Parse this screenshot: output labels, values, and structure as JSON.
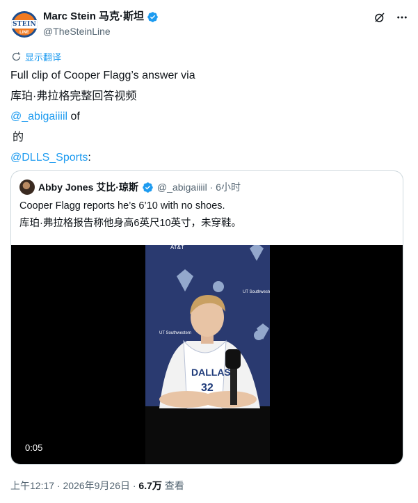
{
  "author": {
    "display_name": "Marc Stein 马克·斯坦",
    "handle": "@TheSteinLine",
    "avatar_text": "STEIN",
    "avatar_subtext": "LINE"
  },
  "translate_label": "显示翻译",
  "tweet": {
    "line1": "Full clip of Cooper Flagg’s answer via",
    "line2": "库珀·弗拉格完整回答视频",
    "mention1": "@_abigaiiiil",
    "after_mention1": " of",
    "line4": "的",
    "mention2": "@DLLS_Sports",
    "after_mention2": ":"
  },
  "quote": {
    "display_name": "Abby Jones 艾比·琼斯",
    "handle_time": "@_abigaiiiil · 6小时",
    "text_en": "Cooper Flagg reports he’s 6’10 with no shoes.",
    "text_zh": "库珀·弗拉格报告称他身高6英尺10英寸，未穿鞋。",
    "video_duration": "0:05"
  },
  "meta": {
    "time_date": "上午12:17 · 2026年9月26日 · ",
    "views_count": "6.7万",
    "views_label": " 查看"
  },
  "video_frame_text": {
    "jersey": "DALLAS",
    "jersey_number": "32",
    "sponsor": "UT Southwestern",
    "att": "AT&T"
  },
  "colors": {
    "link": "#1d9bf0",
    "verified": "#1d9bf0",
    "secondary_text": "#536471",
    "mavs_blue": "#2a3a70"
  }
}
